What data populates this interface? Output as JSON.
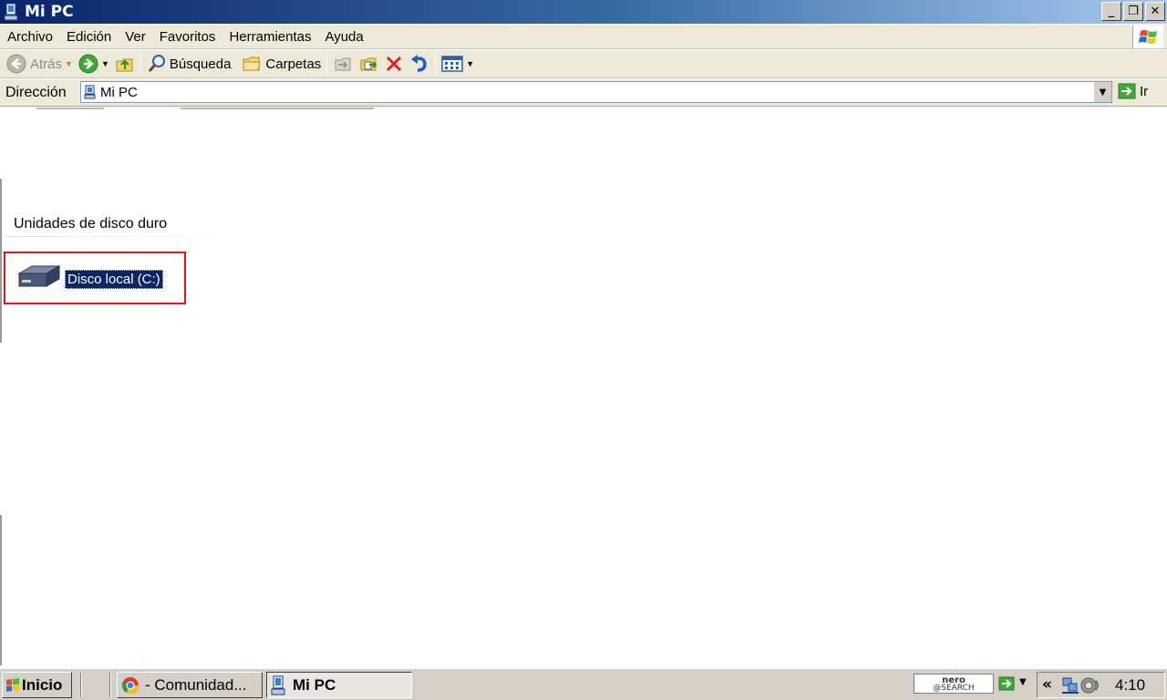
{
  "window": {
    "title": "Mi PC",
    "buttons": {
      "minimize": "_",
      "restore": "❐",
      "close": "✕"
    }
  },
  "menu": {
    "items": [
      "Archivo",
      "Edición",
      "Ver",
      "Favoritos",
      "Herramientas",
      "Ayuda"
    ]
  },
  "toolbar": {
    "back_label": "Atrás",
    "search_label": "Búsqueda",
    "folders_label": "Carpetas"
  },
  "address": {
    "label": "Dirección",
    "value": "Mi PC",
    "go_label": "Ir"
  },
  "content": {
    "group_title": "Unidades de disco duro",
    "drives": [
      {
        "label": "Disco local (C:)"
      }
    ]
  },
  "taskbar": {
    "start_label": "Inicio",
    "tasks": [
      {
        "label": "- Comunidad...",
        "icon": "chrome-icon"
      },
      {
        "label": "Mi PC",
        "icon": "my-computer-icon"
      }
    ],
    "nero": {
      "line1": "nero",
      "line2": "@SEARCH"
    },
    "tray_chevron": "«",
    "clock": "4:10"
  },
  "colors": {
    "titlebar_dark": "#0a246a",
    "titlebar_light": "#a6caf0",
    "chrome_face": "#ece9d8",
    "selection": "#0a246a",
    "highlight_box": "#e01818"
  }
}
